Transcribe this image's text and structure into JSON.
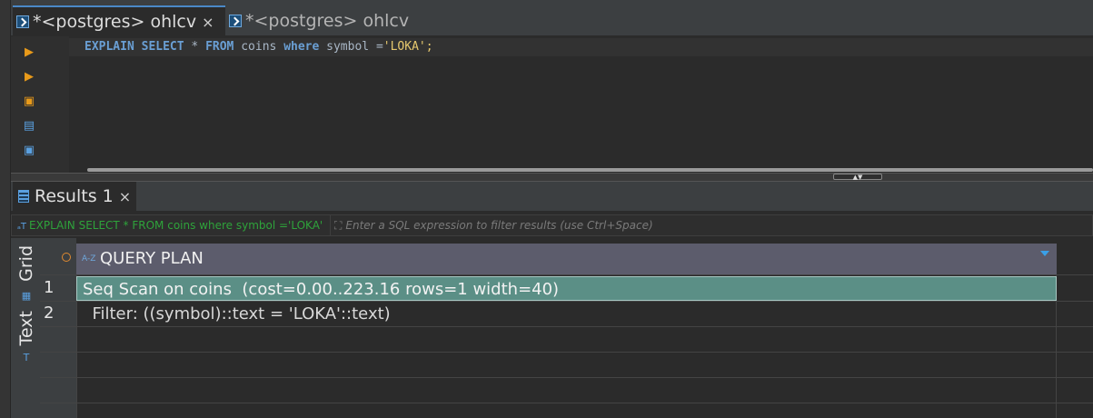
{
  "editor_tabs": [
    {
      "label": "*<postgres> ohlcv",
      "active": true,
      "close": "×"
    },
    {
      "label": "*<postgres> ohlcv",
      "active": false
    }
  ],
  "sql_editor": {
    "tokens": {
      "t1": "EXPLAIN",
      "t2": "SELECT",
      "t3": "*",
      "t4": "FROM",
      "t5": "coins",
      "t6": "where",
      "t7": "symbol",
      "t8": "=",
      "t9": "'LOKA'",
      "t10": ";"
    }
  },
  "results_tab": {
    "label": "Results 1",
    "close": "×"
  },
  "filter": {
    "query_text": "EXPLAIN SELECT * FROM coins where symbol ='LOKA'",
    "placeholder": "Enter a SQL expression to filter results (use Ctrl+Space)"
  },
  "side_tabs": {
    "grid": "Grid",
    "text": "Text"
  },
  "grid": {
    "column_header": "QUERY PLAN",
    "rows": [
      {
        "num": "1",
        "value": "Seq Scan on coins  (cost=0.00..223.16 rows=1 width=40)"
      },
      {
        "num": "2",
        "value": "  Filter: ((symbol)::text = 'LOKA'::text)"
      }
    ]
  },
  "colors": {
    "accent": "#4a88c7",
    "selection": "#5b8f86",
    "keyword": "#6a9fd4",
    "string": "#e6c86e",
    "filter_sql": "#2ea33b"
  }
}
